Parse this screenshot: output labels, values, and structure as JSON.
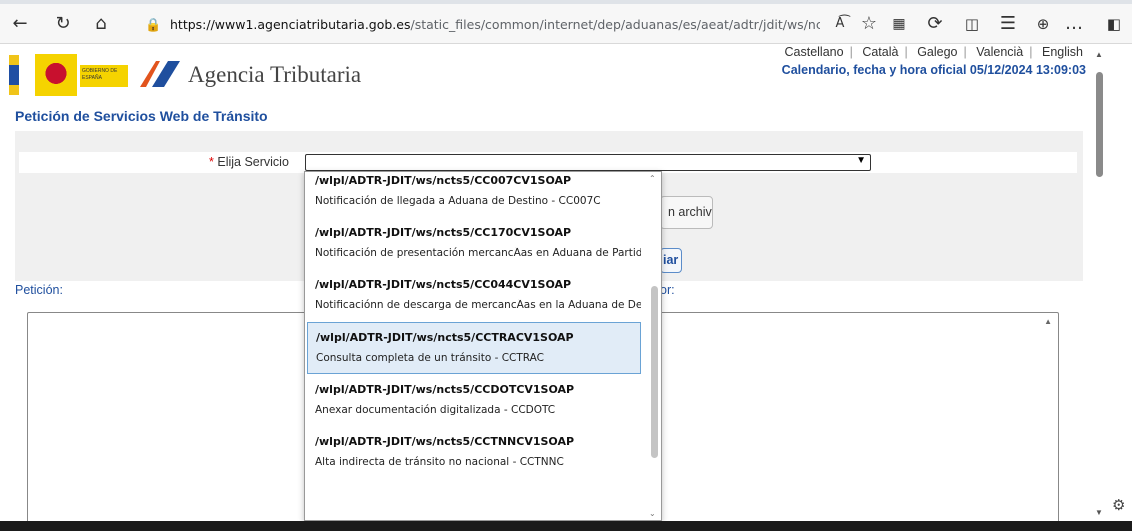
{
  "browser": {
    "url_host": "https://www1.agenciatributaria.gob.es",
    "url_path": "/static_files/common/internet/dep/aduanas/es/aeat/adtr/jdit/ws/ncts5...",
    "icons": [
      "back-icon",
      "refresh-icon",
      "home-icon",
      "lock-icon",
      "read-aloud-icon",
      "favorite-star-icon",
      "extension-icon",
      "sync-icon",
      "split-screen-icon",
      "favorites-icon",
      "collections-icon",
      "more-icon",
      "sidebar-icon"
    ]
  },
  "header": {
    "brand": "Agencia Tributaria",
    "gov_text": "GOBIERNO DE ESPAÑA",
    "languages": [
      "Castellano",
      "Català",
      "Galego",
      "Valencià",
      "English"
    ],
    "calendar": "Calendario, fecha y hora oficial 05/12/2024 13:09:03",
    "colors": {
      "link_blue": "#1f4f9e",
      "required": "#d00000"
    }
  },
  "main": {
    "title": "Petición de Servicios Web de Tránsito",
    "service_label_req": "*",
    "service_label": "Elija Servicio",
    "file_button": "n archivo",
    "send_button": "iar",
    "peticion_label": "Petición:",
    "respuesta_label": "or:"
  },
  "dropdown": {
    "options": [
      {
        "code": "/wlpl/ADTR-JDIT/ws/ncts5/CC007CV1SOAP",
        "desc": "Notificación de llegada a Aduana de Destino - CC007C",
        "selected": false
      },
      {
        "code": "/wlpl/ADTR-JDIT/ws/ncts5/CC170CV1SOAP",
        "desc": "Notificación de presentación mercancÃas en Aduana de Partida -...",
        "selected": false
      },
      {
        "code": "/wlpl/ADTR-JDIT/ws/ncts5/CC044CV1SOAP",
        "desc": "Notificaciónn de descarga de mercancÃas en la Aduana de Destin...",
        "selected": false
      },
      {
        "code": "/wlpl/ADTR-JDIT/ws/ncts5/CCTRACV1SOAP",
        "desc": "Consulta completa de un tránsito - CCTRAC",
        "selected": true
      },
      {
        "code": "/wlpl/ADTR-JDIT/ws/ncts5/CCDOTCV1SOAP",
        "desc": "Anexar documentación digitalizada - CCDOTC",
        "selected": false
      },
      {
        "code": "/wlpl/ADTR-JDIT/ws/ncts5/CCTNNCV1SOAP",
        "desc": "Alta indirecta de tránsito no nacional - CCTNNC",
        "selected": false
      }
    ]
  }
}
